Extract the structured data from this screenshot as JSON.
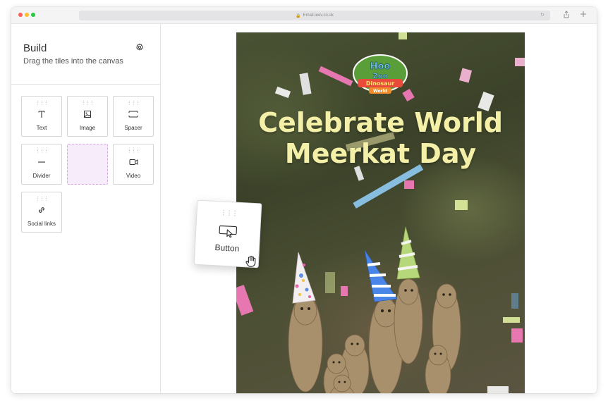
{
  "browser": {
    "url": "Email.ieev.co.uk",
    "reload_icon": "reload-icon",
    "share_icon": "share-icon",
    "new_tab_icon": "plus-icon"
  },
  "sidebar": {
    "title": "Build",
    "subtitle": "Drag the tiles into the canvas",
    "settings_icon": "gear-icon",
    "tiles": [
      {
        "label": "Text",
        "icon": "text-icon"
      },
      {
        "label": "Image",
        "icon": "image-icon"
      },
      {
        "label": "Spacer",
        "icon": "spacer-icon"
      },
      {
        "label": "Divider",
        "icon": "divider-icon"
      },
      {
        "label": "",
        "icon": "drop-placeholder"
      },
      {
        "label": "Video",
        "icon": "video-icon"
      },
      {
        "label": "Social links",
        "icon": "link-icon"
      }
    ]
  },
  "dragging": {
    "label": "Button",
    "icon": "button-cursor-icon",
    "cursor": "grab-hand-icon"
  },
  "email": {
    "headline_line1": "Celebrate World",
    "headline_line2": "Meerkat Day",
    "logo_text": [
      "Hoo",
      "Zoo",
      "Dinosaur",
      "World"
    ]
  },
  "colors": {
    "headline": "#f4f0a8",
    "placeholder_bg": "#f6ecfa",
    "placeholder_border": "#d3a6e0"
  }
}
